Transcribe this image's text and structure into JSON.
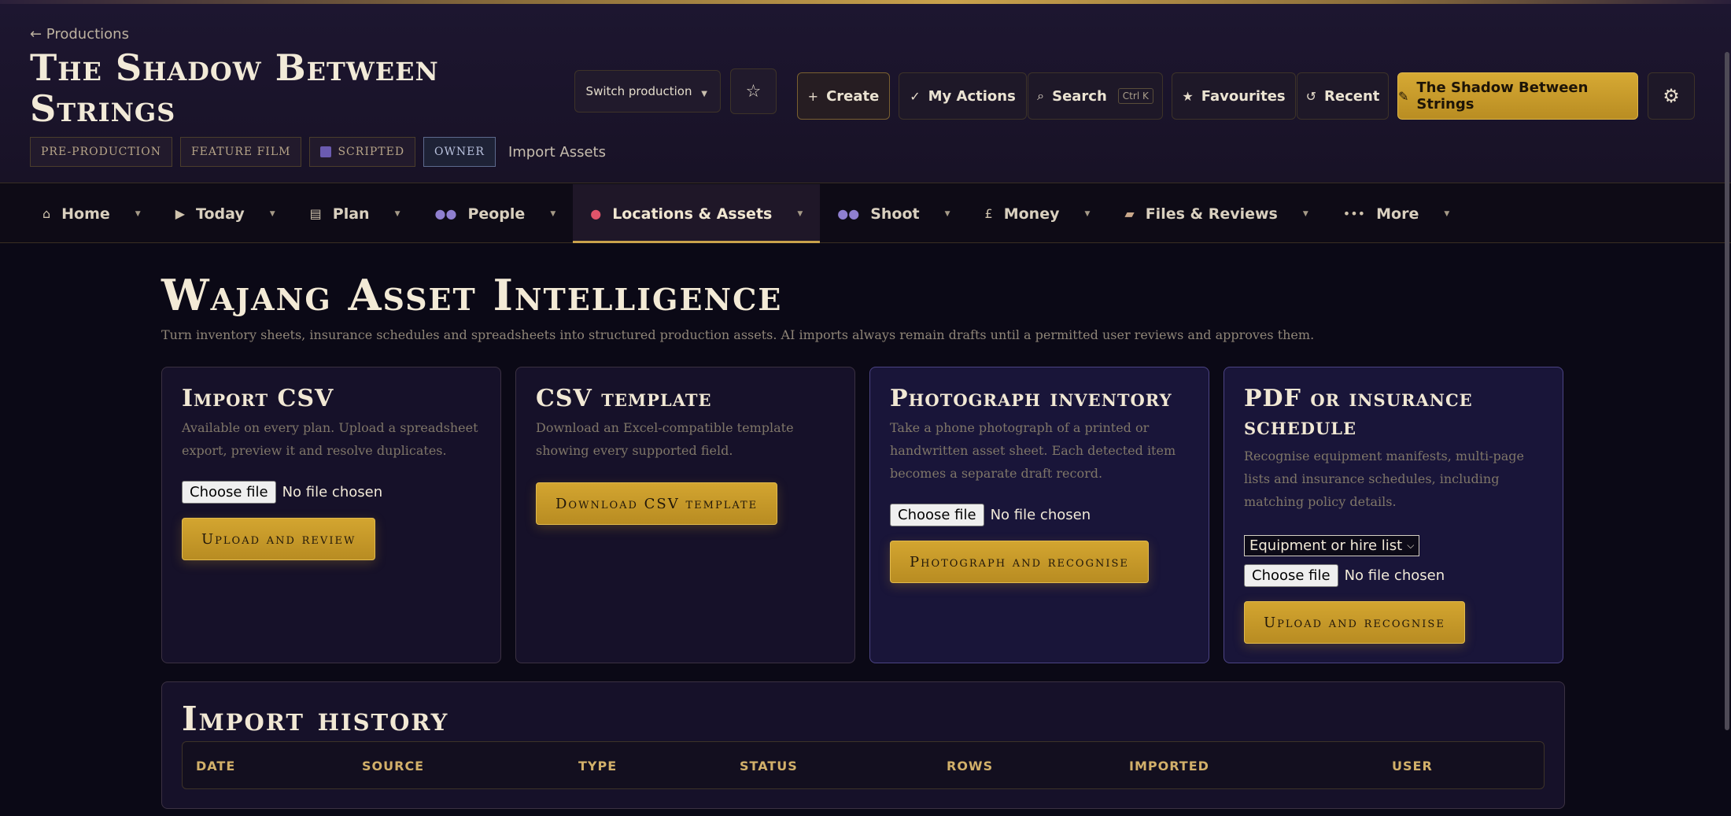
{
  "header": {
    "back_link": "← Productions",
    "production_title": "The Shadow Between Strings",
    "tags": {
      "phase": "PRE-PRODUCTION",
      "format": "FEATURE FILM",
      "script": "SCRIPTED",
      "role": "OWNER"
    },
    "context_label": "Import Assets",
    "switch_production": "Switch production",
    "toolbar": {
      "create": "Create",
      "my_actions": "My Actions",
      "search": "Search",
      "search_shortcut": "Ctrl K",
      "favourites": "Favourites",
      "recent": "Recent",
      "current_production": "The Shadow Between Strings"
    }
  },
  "nav": {
    "home": "Home",
    "today": "Today",
    "plan": "Plan",
    "people": "People",
    "locations_assets": "Locations & Assets",
    "shoot": "Shoot",
    "money": "Money",
    "files_reviews": "Files & Reviews",
    "more": "More",
    "active": "locations_assets"
  },
  "page": {
    "title": "Wajang Asset Intelligence",
    "subtitle": "Turn inventory sheets, insurance schedules and spreadsheets into structured production assets. AI imports always remain drafts until a permitted user reviews and approves them."
  },
  "cards": {
    "import_csv": {
      "title": "Import CSV",
      "description": "Available on every plan. Upload a spreadsheet export, preview it and resolve duplicates.",
      "file_button": "Choose file",
      "file_status": "No file chosen",
      "action": "Upload and review"
    },
    "csv_template": {
      "title": "CSV template",
      "description": "Download an Excel-compatible template showing every supported field.",
      "action": "Download CSV template"
    },
    "photograph": {
      "title": "Photograph inventory",
      "description": "Take a phone photograph of a printed or handwritten asset sheet. Each detected item becomes a separate draft record.",
      "file_button": "Choose file",
      "file_status": "No file chosen",
      "action": "Photograph and recognise"
    },
    "pdf": {
      "title": "PDF or insurance schedule",
      "description": "Recognise equipment manifests, multi-page lists and insurance schedules, including matching policy details.",
      "select_value": "Equipment or hire list",
      "file_button": "Choose file",
      "file_status": "No file chosen",
      "action": "Upload and recognise"
    }
  },
  "history": {
    "title": "Import history",
    "columns": [
      "DATE",
      "SOURCE",
      "TYPE",
      "STATUS",
      "ROWS",
      "IMPORTED",
      "USER"
    ]
  },
  "colors": {
    "accent_gold": "#c9a24c",
    "background": "#0b0916",
    "card_bg": "#161129",
    "highlight_card_bg": "#191539"
  }
}
